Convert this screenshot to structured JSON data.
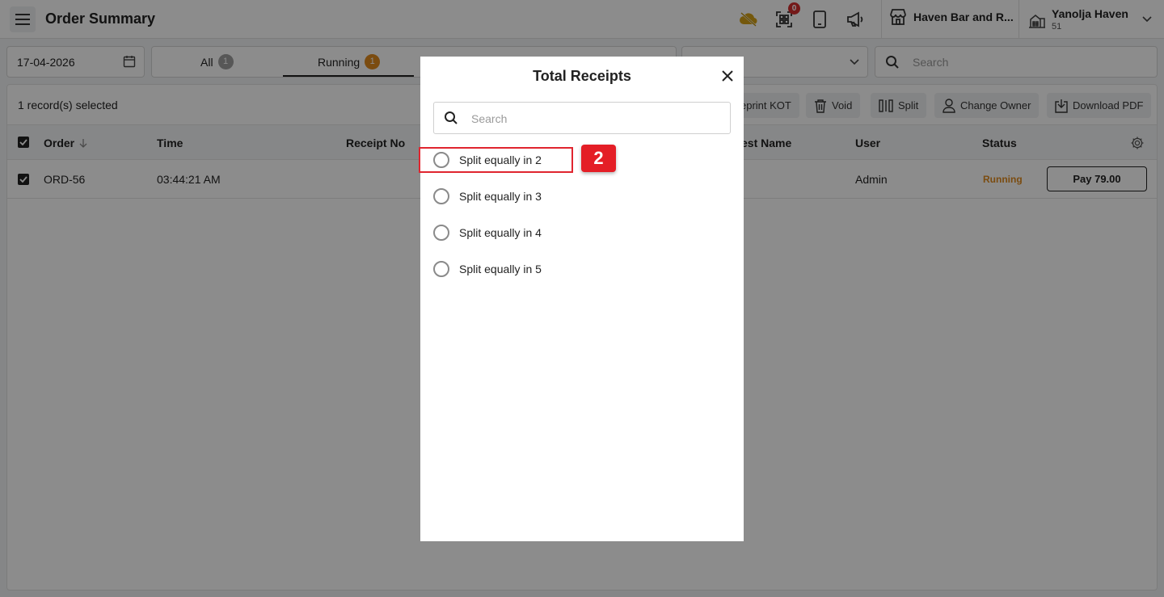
{
  "header": {
    "title": "Order Summary",
    "qr_badge": "0",
    "store": "Haven Bar and R...",
    "property": "Yanolja Haven",
    "property_sub": "51"
  },
  "filters": {
    "date": "17-04-2026",
    "tabs": [
      {
        "label": "All",
        "count": "1",
        "color": "#9e9e9e"
      },
      {
        "label": "Running",
        "count": "1",
        "color": "#e08a1e"
      }
    ],
    "search_placeholder": "Search"
  },
  "toolbar": {
    "selected": "1 record(s) selected",
    "reprint": "eprint KOT",
    "void": "Void",
    "split": "Split",
    "change_owner": "Change Owner",
    "download_pdf": "Download PDF"
  },
  "table": {
    "columns": [
      "Order",
      "Time",
      "Receipt No",
      "est Name",
      "User",
      "Status"
    ],
    "rows": [
      {
        "order": "ORD-56",
        "time": "03:44:21 AM",
        "user": "Admin",
        "status": "Running",
        "pay": "Pay 79.00"
      }
    ]
  },
  "modal": {
    "title": "Total Receipts",
    "search_placeholder": "Search",
    "options": [
      "Split equally in 2",
      "Split equally in 3",
      "Split equally in 4",
      "Split equally in 5"
    ]
  },
  "annotation": {
    "step": "2"
  },
  "colors": {
    "accent_running": "#e08a1e",
    "highlight": "#e0252f"
  }
}
